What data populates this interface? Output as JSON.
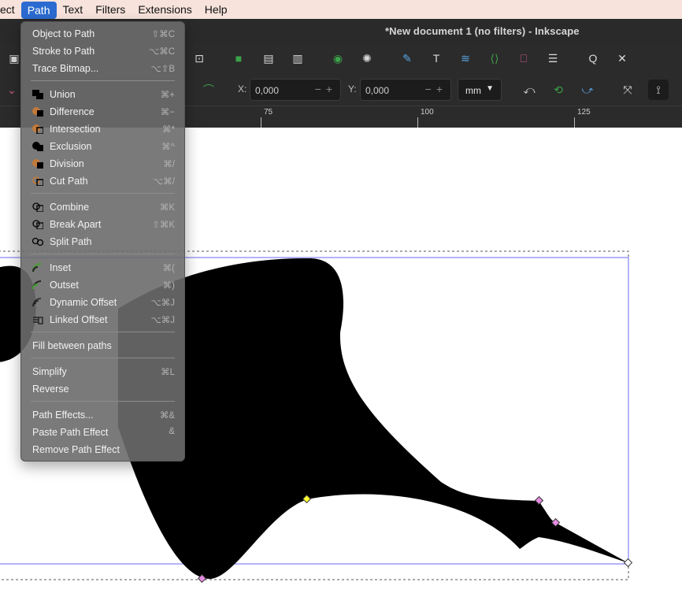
{
  "menubar": {
    "items": [
      "ect",
      "Path",
      "Text",
      "Filters",
      "Extensions",
      "Help"
    ],
    "active": "Path"
  },
  "window": {
    "title": "*New document 1 (no filters) - Inkscape"
  },
  "toolbar2": {
    "x_label": "X:",
    "x_value": "0,000",
    "y_label": "Y:",
    "y_value": "0,000",
    "unit": "mm",
    "unit_caret": "▼"
  },
  "ruler": {
    "labels": [
      "75",
      "100",
      "125"
    ]
  },
  "path_menu": {
    "items": [
      {
        "label": "Object to Path",
        "shortcut": "⇧⌘C"
      },
      {
        "label": "Stroke to Path",
        "shortcut": "⌥⌘C"
      },
      {
        "label": "Trace Bitmap...",
        "shortcut": "⌥⇧B"
      },
      {
        "label": "Union",
        "shortcut": "⌘+"
      },
      {
        "label": "Difference",
        "shortcut": "⌘−"
      },
      {
        "label": "Intersection",
        "shortcut": "⌘*"
      },
      {
        "label": "Exclusion",
        "shortcut": "⌘^"
      },
      {
        "label": "Division",
        "shortcut": "⌘/"
      },
      {
        "label": "Cut Path",
        "shortcut": "⌥⌘/"
      },
      {
        "label": "Combine",
        "shortcut": "⌘K"
      },
      {
        "label": "Break Apart",
        "shortcut": "⇧⌘K"
      },
      {
        "label": "Split Path",
        "shortcut": ""
      },
      {
        "label": "Inset",
        "shortcut": "⌘("
      },
      {
        "label": "Outset",
        "shortcut": "⌘)"
      },
      {
        "label": "Dynamic Offset",
        "shortcut": "⌥⌘J"
      },
      {
        "label": "Linked Offset",
        "shortcut": "⌥⌘J"
      },
      {
        "label": "Fill between paths",
        "shortcut": ""
      },
      {
        "label": "Simplify",
        "shortcut": "⌘L"
      },
      {
        "label": "Reverse",
        "shortcut": ""
      },
      {
        "label": "Path Effects...",
        "shortcut": "⌘&"
      },
      {
        "label": "Paste Path Effect",
        "shortcut": "&"
      },
      {
        "label": "Remove Path Effect",
        "shortcut": ""
      }
    ]
  },
  "colors": {
    "menubar_bg": "#f7e3dc",
    "menu_active": "#2b6bd1",
    "chrome_bg": "#2b2b2b",
    "menu_bg": "#6c6c6c",
    "selection_blue": "#6a6af0",
    "node_pink": "#e58be0",
    "node_yellow": "#ffff33"
  }
}
